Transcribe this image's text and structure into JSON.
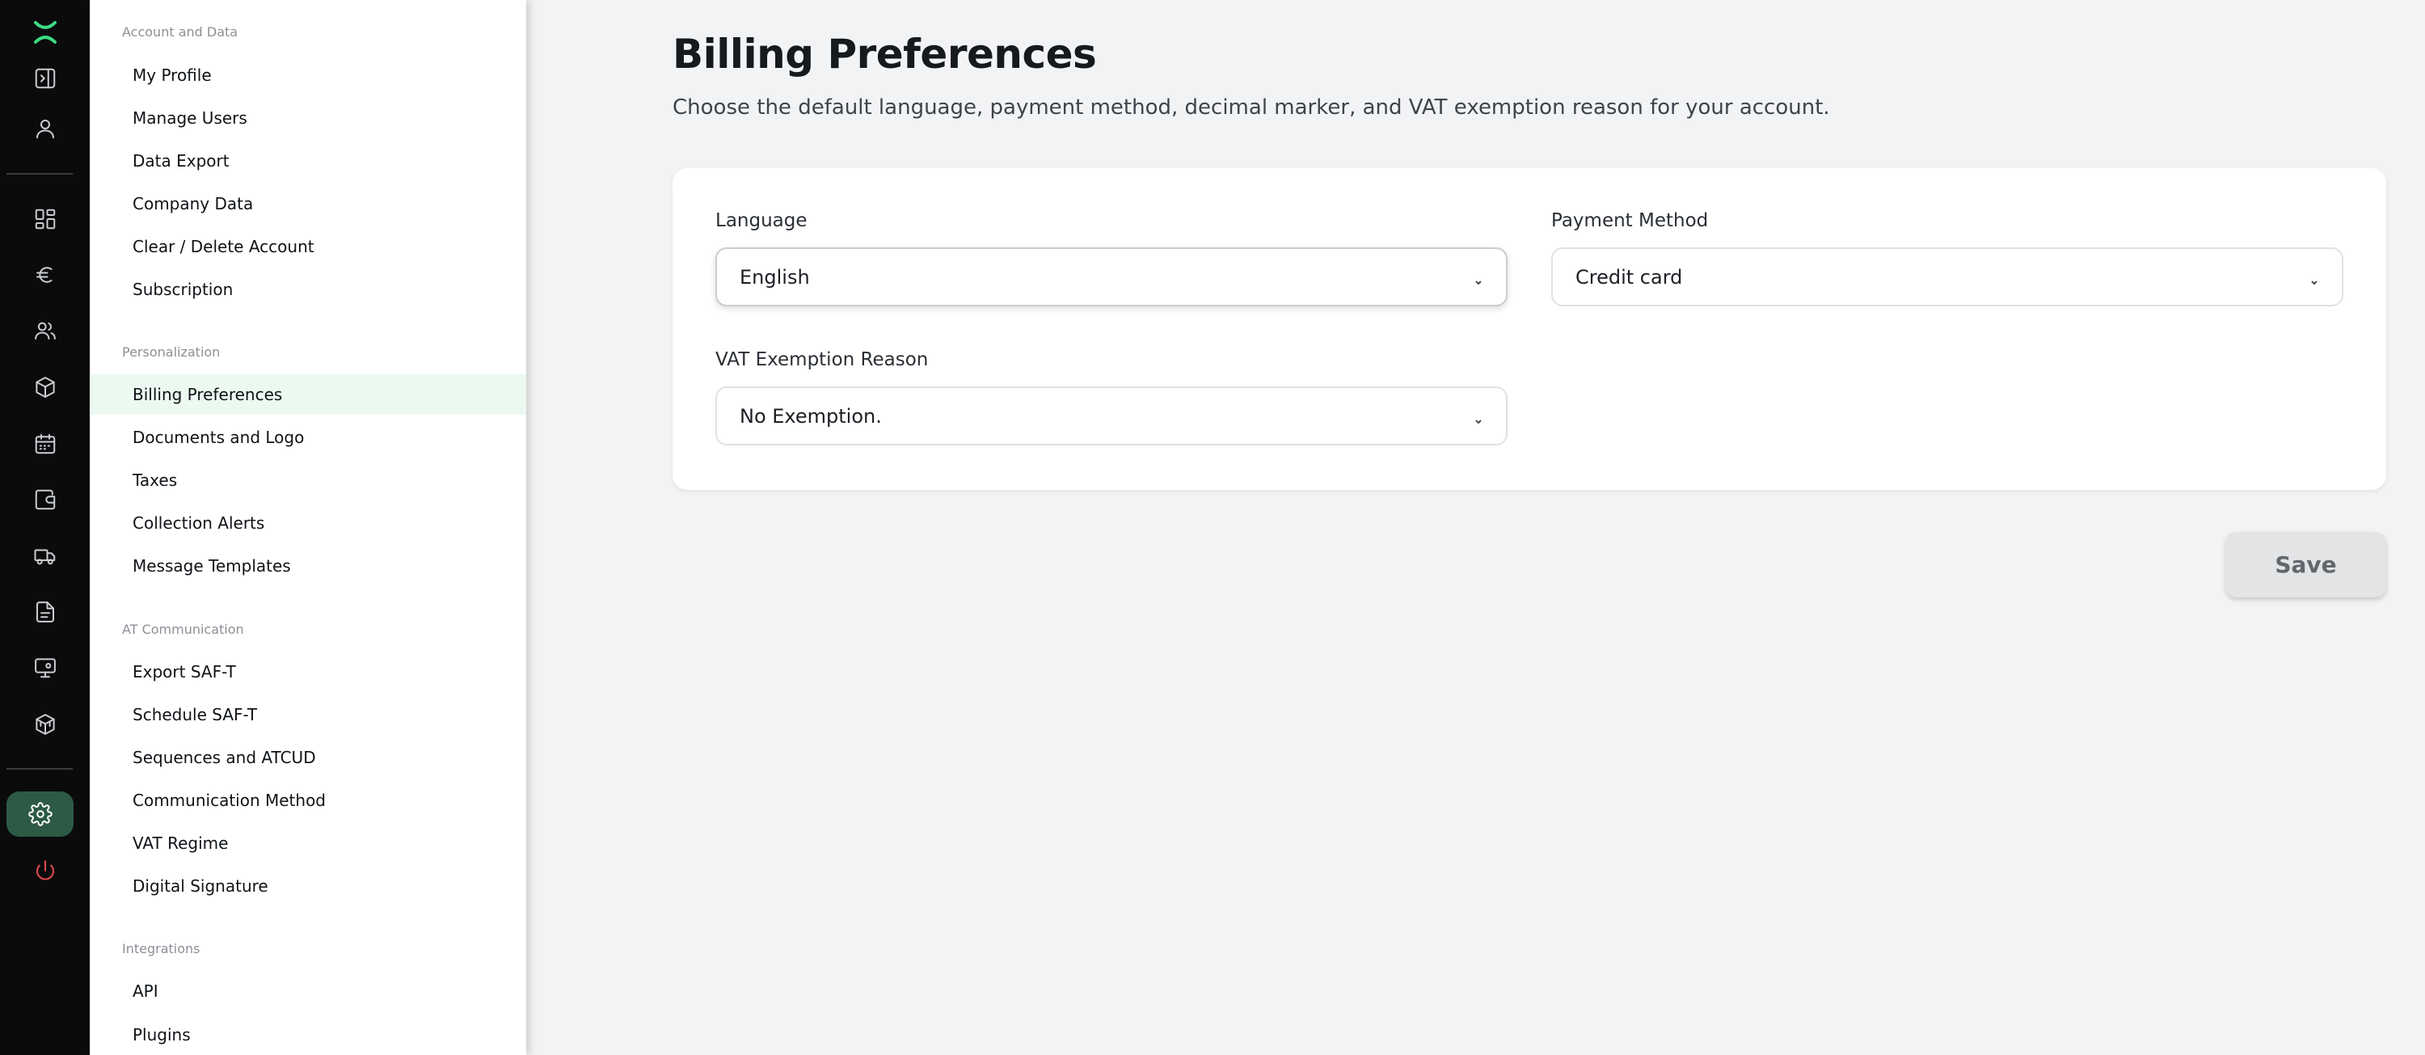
{
  "rail": {
    "items": [
      {
        "icon": "app-logo-icon"
      },
      {
        "icon": "sidebar-toggle-icon"
      },
      {
        "icon": "user-profile-icon"
      },
      {
        "icon": "dashboard-icon"
      },
      {
        "icon": "euro-icon"
      },
      {
        "icon": "customers-icon"
      },
      {
        "icon": "box-icon"
      },
      {
        "icon": "calendar-icon"
      },
      {
        "icon": "wallet-icon"
      },
      {
        "icon": "truck-icon"
      },
      {
        "icon": "document-icon"
      },
      {
        "icon": "monitor-icon"
      },
      {
        "icon": "boxes-icon"
      },
      {
        "icon": "settings-icon",
        "active": true
      },
      {
        "icon": "power-icon",
        "color": "#e5484d"
      }
    ],
    "active_bg": "#2d5a45"
  },
  "sidebar": {
    "sections": [
      {
        "title": "Account and Data",
        "items": [
          "My Profile",
          "Manage Users",
          "Data Export",
          "Company Data",
          "Clear / Delete Account",
          "Subscription"
        ]
      },
      {
        "title": "Personalization",
        "items": [
          "Billing Preferences",
          "Documents and Logo",
          "Taxes",
          "Collection Alerts",
          "Message Templates"
        ]
      },
      {
        "title": "AT Communication",
        "items": [
          "Export SAF-T",
          "Schedule SAF-T",
          "Sequences and ATCUD",
          "Communication Method",
          "VAT Regime",
          "Digital Signature"
        ]
      },
      {
        "title": "Integrations",
        "items": [
          "API",
          "Plugins"
        ]
      }
    ],
    "active_item": "Billing Preferences",
    "active_bg": "#ecf9f1"
  },
  "main": {
    "title": "Billing Preferences",
    "subtitle": "Choose the default language, payment method, decimal marker, and VAT exemption reason for your account.",
    "fields": {
      "language": {
        "label": "Language",
        "value": "English"
      },
      "payment_method": {
        "label": "Payment Method",
        "value": "Credit card"
      },
      "vat_exemption": {
        "label": "VAT Exemption Reason",
        "value": "No Exemption."
      }
    },
    "save_label": "Save"
  }
}
